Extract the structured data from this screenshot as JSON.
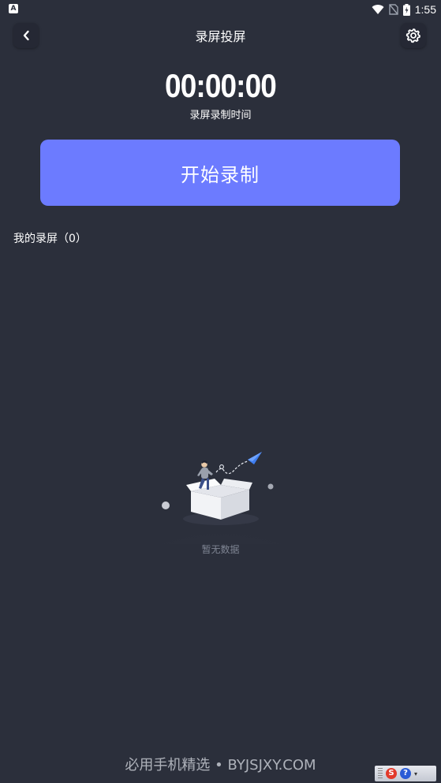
{
  "status_bar": {
    "left_icon_letter": "A",
    "time": "1:55",
    "icons": [
      "wifi-icon",
      "no-sim-icon",
      "battery-charging-icon"
    ]
  },
  "header": {
    "title": "录屏投屏",
    "back_icon": "chevron-left-icon",
    "settings_icon": "gear-icon"
  },
  "timer": {
    "value": "00:00:00",
    "label": "录屏录制时间"
  },
  "start_button": {
    "label": "开始录制"
  },
  "recordings": {
    "label": "我的录屏（0）",
    "count": 0
  },
  "empty_state": {
    "icon": "empty-box-illustration",
    "text": "暂无数据"
  },
  "watermark": {
    "text": "必用手机精选 • BYJSJXY.COM"
  },
  "ime_toolbar": {
    "s_letter": "S",
    "help_letter": "?"
  },
  "colors": {
    "background": "#2b2f3b",
    "button": "#6c7bff",
    "muted_text": "#7f8593"
  }
}
